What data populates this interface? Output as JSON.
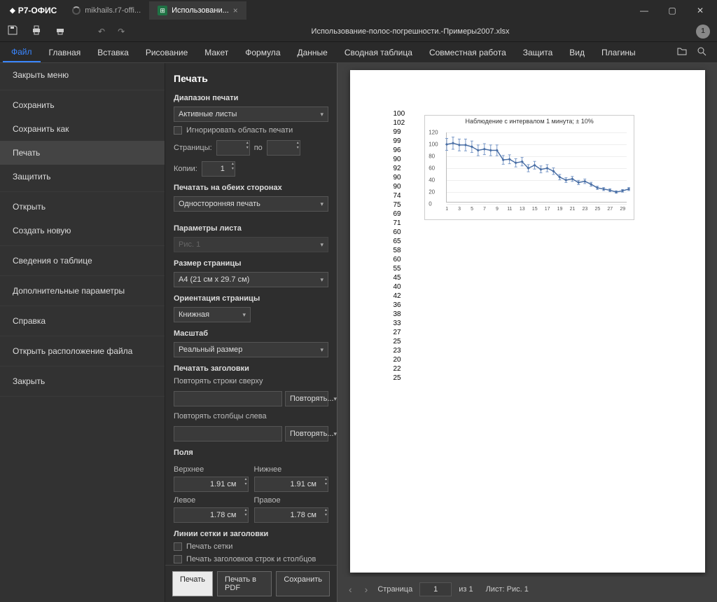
{
  "app": {
    "name": "Р7-ОФИС"
  },
  "tabs": [
    {
      "title": "mikhails.r7-offi..."
    },
    {
      "title": "Использовани..."
    }
  ],
  "doc_title": "Использование-полос-погрешности.-Примеры2007.xlsx",
  "menu": [
    "Файл",
    "Главная",
    "Вставка",
    "Рисование",
    "Макет",
    "Формула",
    "Данные",
    "Сводная таблица",
    "Совместная работа",
    "Защита",
    "Вид",
    "Плагины"
  ],
  "sidebar": [
    "Закрыть меню",
    "Сохранить",
    "Сохранить как",
    "Печать",
    "Защитить",
    "Открыть",
    "Создать новую",
    "Сведения о таблице",
    "Дополнительные параметры",
    "Справка",
    "Открыть расположение файла",
    "Закрыть"
  ],
  "panel": {
    "title": "Печать",
    "range_label": "Диапазон печати",
    "range_value": "Активные листы",
    "ignore_print_area": "Игнорировать область печати",
    "pages_label": "Страницы:",
    "pages_to": "по",
    "copies_label": "Копии:",
    "copies_value": "1",
    "duplex_label": "Печатать на обеих сторонах",
    "duplex_value": "Односторонняя печать",
    "sheet_params_label": "Параметры листа",
    "sheet_value": "Рис. 1",
    "page_size_label": "Размер страницы",
    "page_size_value": "A4 (21 см x 29.7 см)",
    "orient_label": "Ориентация страницы",
    "orient_value": "Книжная",
    "scale_label": "Масштаб",
    "scale_value": "Реальный размер",
    "print_headers_label": "Печатать заголовки",
    "repeat_rows_label": "Повторять строки сверху",
    "repeat_btn": "Повторять...",
    "repeat_cols_label": "Повторять столбцы слева",
    "margins_label": "Поля",
    "margin_top": "Верхнее",
    "margin_bottom": "Нижнее",
    "margin_left": "Левое",
    "margin_right": "Правое",
    "margin_tv": "1.91 см",
    "margin_bv": "1.91 см",
    "margin_lv": "1.78 см",
    "margin_rv": "1.78 см",
    "grid_head_label": "Линии сетки и заголовки",
    "print_grid": "Печать сетки",
    "print_rowcol_headers": "Печать заголовков строк и столбцов",
    "btn_print": "Печать",
    "btn_pdf": "Печать в PDF",
    "btn_save": "Сохранить"
  },
  "preview_left_column": [
    "100",
    "102",
    "99",
    "99",
    "96",
    "90",
    "92",
    "90",
    "90",
    "74",
    "75",
    "69",
    "71",
    "60",
    "65",
    "58",
    "60",
    "55",
    "45",
    "40",
    "42",
    "36",
    "38",
    "33",
    "27",
    "25",
    "23",
    "20",
    "22",
    "25"
  ],
  "preview_footer": {
    "page_label": "Страница",
    "page": "1",
    "of": "из 1",
    "sheet_label": "Лист:",
    "sheet": "Рис. 1"
  },
  "chart_data": {
    "type": "line",
    "title": "Наблюдение с интервалом 1 минута; ± 10%",
    "xlabel": "",
    "ylabel": "",
    "ylim": [
      0,
      120
    ],
    "x": [
      1,
      2,
      3,
      4,
      5,
      6,
      7,
      8,
      9,
      10,
      11,
      12,
      13,
      14,
      15,
      16,
      17,
      18,
      19,
      20,
      21,
      22,
      23,
      24,
      25,
      26,
      27,
      28,
      29,
      30
    ],
    "series": [
      {
        "name": "Наблюдение",
        "values": [
          100,
          102,
          99,
          99,
          96,
          90,
          92,
          90,
          90,
          74,
          75,
          69,
          71,
          60,
          65,
          58,
          60,
          55,
          45,
          40,
          42,
          36,
          38,
          33,
          27,
          25,
          23,
          20,
          22,
          25
        ],
        "error_pct": 10
      }
    ],
    "y_ticks": [
      0,
      20,
      40,
      60,
      80,
      100,
      120
    ],
    "x_ticks": [
      1,
      3,
      5,
      7,
      9,
      11,
      13,
      15,
      17,
      19,
      21,
      23,
      25,
      27,
      29
    ]
  }
}
